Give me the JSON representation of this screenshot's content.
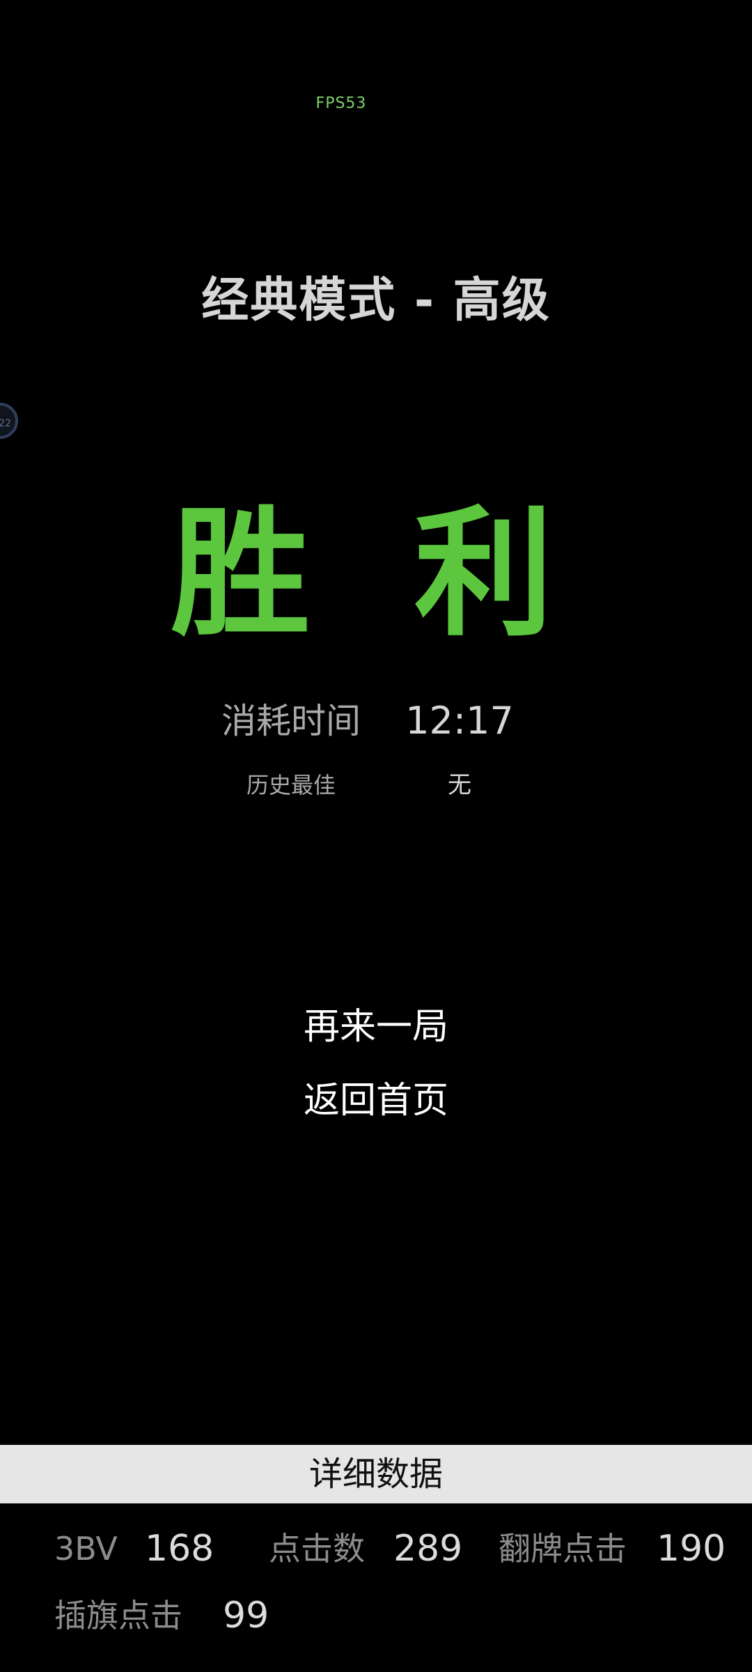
{
  "fps_text": "FPS53",
  "title": "经典模式 - 高级",
  "floating_badge": "22",
  "result": "胜 利",
  "stats": {
    "time_label": "消耗时间",
    "time_value": "12:17",
    "best_label": "历史最佳",
    "best_value": "无"
  },
  "buttons": {
    "play_again": "再来一局",
    "back_home": "返回首页"
  },
  "details": {
    "header": "详细数据",
    "bv_label": "3BV",
    "bv_value": "168",
    "clicks_label": "点击数",
    "clicks_value": "289",
    "reveal_label": "翻牌点击",
    "reveal_value": "190",
    "flag_label": "插旗点击",
    "flag_value": "99"
  },
  "colors": {
    "background": "#000000",
    "win_green": "#5cc73e",
    "fps_green": "#7fd06a",
    "detail_bar": "#e6e6e6"
  }
}
